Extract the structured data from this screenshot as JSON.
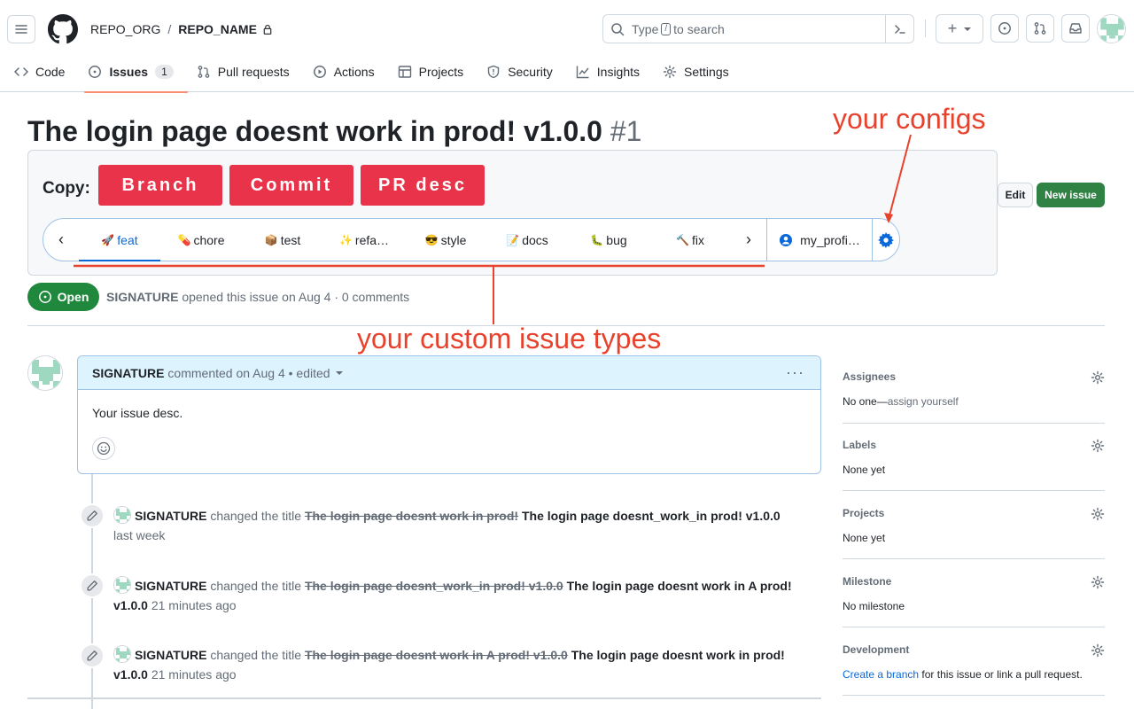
{
  "header": {
    "org": "REPO_ORG",
    "separator": "/",
    "repo": "REPO_NAME",
    "search_prefix": "Type",
    "search_key": "/",
    "search_suffix": "to search",
    "plus_label": "+"
  },
  "tabs": [
    {
      "label": "Code",
      "icon": "code-icon"
    },
    {
      "label": "Issues",
      "icon": "issue-opened-icon",
      "count": "1",
      "active": true
    },
    {
      "label": "Pull requests",
      "icon": "git-pull-request-icon"
    },
    {
      "label": "Actions",
      "icon": "play-icon"
    },
    {
      "label": "Projects",
      "icon": "table-icon"
    },
    {
      "label": "Security",
      "icon": "shield-icon"
    },
    {
      "label": "Insights",
      "icon": "graph-icon"
    },
    {
      "label": "Settings",
      "icon": "gear-icon"
    }
  ],
  "issue": {
    "title": "The login page doesnt work in prod! v1.0.0",
    "number": "#1",
    "status": "Open",
    "author": "SIGNATURE",
    "meta": "opened this issue on Aug 4 · 0 comments"
  },
  "extension": {
    "copy_label": "Copy:",
    "buttons": [
      "Branch",
      "Commit",
      "PR desc"
    ],
    "prev_arrow": "‹",
    "next_arrow": "›",
    "types": [
      {
        "emoji": "🚀",
        "label": "feat",
        "active": true
      },
      {
        "emoji": "💊",
        "label": "chore"
      },
      {
        "emoji": "📦",
        "label": "test"
      },
      {
        "emoji": "✨",
        "label": "refa…"
      },
      {
        "emoji": "😎",
        "label": "style"
      },
      {
        "emoji": "📝",
        "label": "docs"
      },
      {
        "emoji": "🐛",
        "label": "bug"
      },
      {
        "emoji": "🔨",
        "label": "fix"
      }
    ],
    "profile": "my_profi…"
  },
  "annotations": {
    "configs": "your configs",
    "types": "your custom issue types",
    "color": "#e8412c"
  },
  "actions": {
    "edit": "Edit",
    "new_issue": "New issue"
  },
  "comment": {
    "author": "SIGNATURE",
    "meta": "commented on Aug 4 • edited",
    "body": "Your issue desc.",
    "more": "···"
  },
  "timeline": [
    {
      "author": "SIGNATURE",
      "action": "changed the title",
      "old": "The login page doesnt work in prod!",
      "new": "The login page doesnt_work_in prod! v1.0.0",
      "time": "last week"
    },
    {
      "author": "SIGNATURE",
      "action": "changed the title",
      "old": "The login page doesnt_work_in prod! v1.0.0",
      "new": "The login page doesnt work in A prod! v1.0.0",
      "time": "21 minutes ago"
    },
    {
      "author": "SIGNATURE",
      "action": "changed the title",
      "old": "The login page doesnt work in A prod! v1.0.0",
      "new": "The login page doesnt work in prod! v1.0.0",
      "time": "21 minutes ago"
    }
  ],
  "sidebar": {
    "assignees": {
      "title": "Assignees",
      "value": "No one—",
      "link": "assign yourself"
    },
    "labels": {
      "title": "Labels",
      "value": "None yet"
    },
    "projects": {
      "title": "Projects",
      "value": "None yet"
    },
    "milestone": {
      "title": "Milestone",
      "value": "No milestone"
    },
    "development": {
      "title": "Development",
      "link": "Create a branch",
      "value": " for this issue or link a pull request."
    }
  },
  "colors": {
    "accent_red": "#e8334a",
    "open_green": "#1f883d",
    "link_blue": "#0969da"
  }
}
